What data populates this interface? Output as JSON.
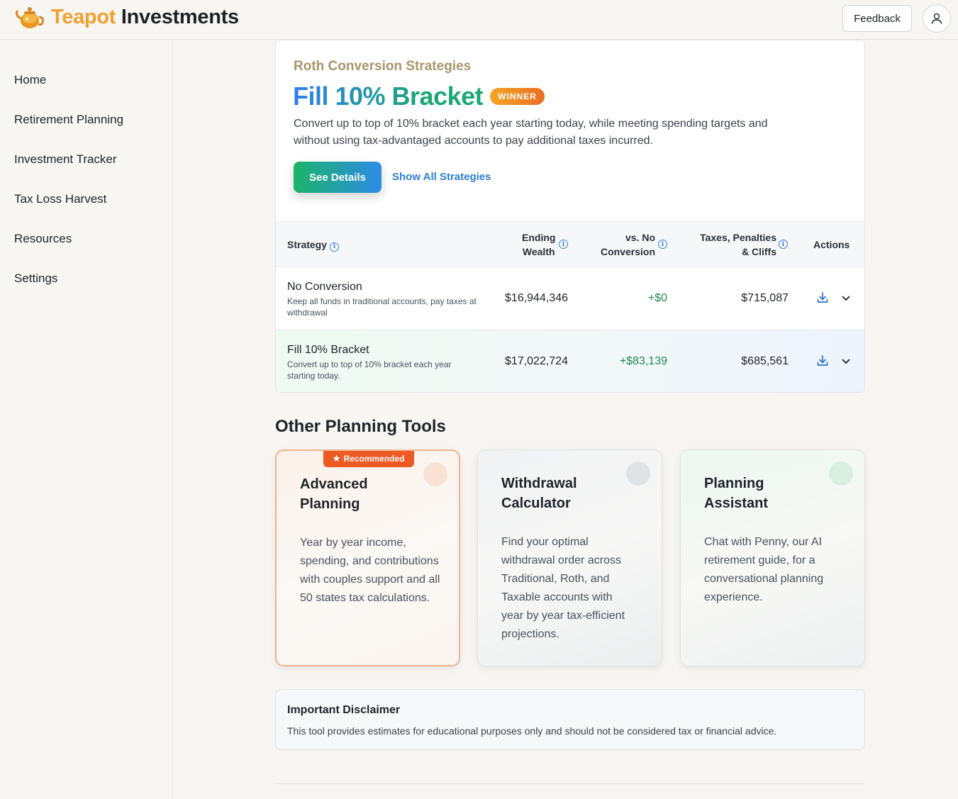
{
  "header": {
    "brand_part1": "Teapot",
    "brand_part2": " Investments",
    "feedback_label": "Feedback"
  },
  "sidebar": {
    "items": [
      {
        "label": "Home"
      },
      {
        "label": "Retirement Planning"
      },
      {
        "label": "Investment Tracker"
      },
      {
        "label": "Tax Loss Harvest"
      },
      {
        "label": "Resources"
      },
      {
        "label": "Settings"
      }
    ]
  },
  "strategy_card": {
    "eyebrow": "Roth Conversion Strategies",
    "title": "Fill 10% Bracket",
    "badge": "WINNER",
    "description": "Convert up to top of 10% bracket each year starting today, while meeting spending targets and without using tax-advantaged accounts to pay additional taxes incurred.",
    "see_details_label": "See Details",
    "show_all_label": "Show All Strategies",
    "table": {
      "headers": {
        "strategy": "Strategy",
        "ending_wealth_1": "Ending",
        "ending_wealth_2": "Wealth",
        "vs_no_conv_1": "vs. No",
        "vs_no_conv_2": "Conversion",
        "taxes_1": "Taxes, Penalties",
        "taxes_2": "& Cliffs",
        "actions": "Actions"
      },
      "rows": [
        {
          "name": "No Conversion",
          "subtitle": "Keep all funds in traditional accounts, pay taxes at withdrawal",
          "ending_wealth": "$16,944,346",
          "vs_no_conversion": "+$0",
          "taxes": "$715,087"
        },
        {
          "name": "Fill 10% Bracket",
          "subtitle": "Convert up to top of 10% bracket each year starting today.",
          "ending_wealth": "$17,022,724",
          "vs_no_conversion": "+$83,139",
          "taxes": "$685,561"
        }
      ]
    }
  },
  "other_tools": {
    "title": "Other Planning Tools",
    "cards": [
      {
        "badge": "Recommended",
        "title": "Advanced Planning",
        "description": "Year by year income, spending, and contributions with couples support and all 50 states tax calculations."
      },
      {
        "title": "Withdrawal Calculator",
        "description": "Find your optimal withdrawal order across Traditional, Roth, and Taxable accounts with year by year tax-efficient projections."
      },
      {
        "title": "Planning Assistant",
        "description": "Chat with Penny, our AI retirement guide, for a conversational planning experience."
      }
    ]
  },
  "disclaimer": {
    "title": "Important Disclaimer",
    "text": "This tool provides estimates for educational purposes only and should not be considered tax or financial advice."
  },
  "icons": {
    "logo": "teapot-icon",
    "user": "user-icon",
    "info": "info-icon",
    "download": "download-icon",
    "expand": "chevron-down-icon",
    "star": "star-icon"
  },
  "colors": {
    "brand_orange": "#f0a12f",
    "accent_green": "#1b8a4d",
    "link_blue": "#2d7fd8",
    "winner_badge": "#ea6e24",
    "recommended_badge": "#ee5a24"
  }
}
